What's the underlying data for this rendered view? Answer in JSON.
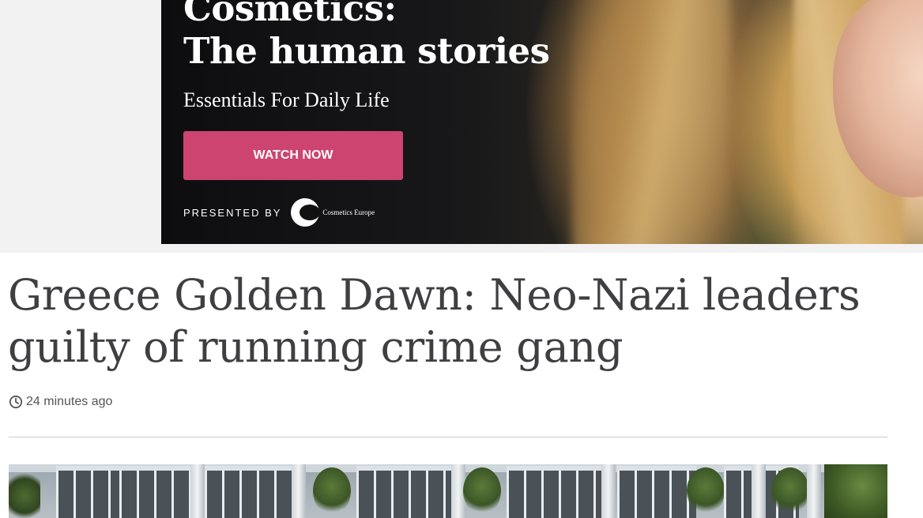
{
  "ad": {
    "title": "Cosmetics:\nThe human stories",
    "subtitle": "Essentials For Daily Life",
    "cta_label": "WATCH NOW",
    "presented_by": "PRESENTED BY",
    "sponsor_name": "Cosmetics Europe",
    "cta_color": "#cd4470"
  },
  "article": {
    "headline": "Greece Golden Dawn: Neo-Nazi leaders guilty of running crime gang",
    "timestamp": "24 minutes ago",
    "timestamp_icon": "clock-icon",
    "headline_color": "#3f3f42"
  }
}
